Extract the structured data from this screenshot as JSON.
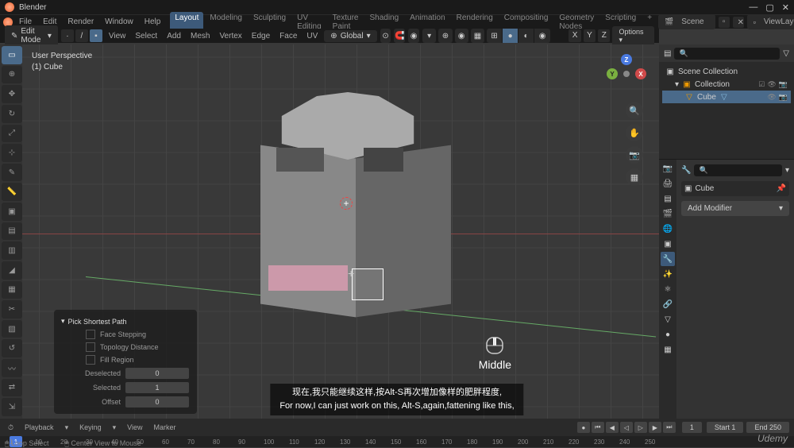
{
  "titlebar": {
    "app": "Blender"
  },
  "menus": {
    "file": "File",
    "edit": "Edit",
    "render": "Render",
    "window": "Window",
    "help": "Help"
  },
  "workspaces": {
    "layout": "Layout",
    "modeling": "Modeling",
    "sculpting": "Sculpting",
    "uv": "UV Editing",
    "texpaint": "Texture Paint",
    "shading": "Shading",
    "animation": "Animation",
    "rendering": "Rendering",
    "compositing": "Compositing",
    "geonodes": "Geometry Nodes",
    "scripting": "Scripting",
    "plus": "+"
  },
  "scene": {
    "label": "Scene",
    "viewlayer": "ViewLayer"
  },
  "toolbar": {
    "mode": "Edit Mode",
    "view": "View",
    "select": "Select",
    "add": "Add",
    "mesh": "Mesh",
    "vertex": "Vertex",
    "edge": "Edge",
    "face": "Face",
    "uv": "UV",
    "global": "Global",
    "options": "Options"
  },
  "viewport": {
    "info1": "User Perspective",
    "info2": "(1) Cube"
  },
  "gizmo": {
    "x": "X",
    "y": "Y",
    "z": "Z"
  },
  "xyz": {
    "x": "X",
    "y": "Y",
    "z": "Z"
  },
  "op_panel": {
    "title": "Pick Shortest Path",
    "face_stepping": "Face Stepping",
    "topo_dist": "Topology Distance",
    "fill_region": "Fill Region",
    "deselected": "Deselected",
    "deselected_v": "0",
    "selected": "Selected",
    "selected_v": "1",
    "offset": "Offset",
    "offset_v": "0"
  },
  "mouse": {
    "label": "Middle"
  },
  "subtitle": {
    "cn": "现在,我只能继续这样,按Alt-S再次增加像样的肥胖程度,",
    "en": "For now,I can just work on this, Alt-S,again,fattening like this,"
  },
  "outliner": {
    "scene_coll": "Scene Collection",
    "collection": "Collection",
    "cube": "Cube"
  },
  "props": {
    "cube": "Cube",
    "add_mod": "Add Modifier"
  },
  "timeline": {
    "playback": "Playback",
    "keying": "Keying",
    "view": "View",
    "marker": "Marker",
    "start": "Start",
    "start_v": "1",
    "end": "End",
    "end_v": "250",
    "current": "1"
  },
  "ruler": {
    "ticks": [
      "1",
      "10",
      "20",
      "30",
      "40",
      "50",
      "60",
      "70",
      "80",
      "90",
      "100",
      "110",
      "120",
      "130",
      "140",
      "150",
      "160",
      "170",
      "180",
      "190",
      "200",
      "210",
      "220",
      "230",
      "240",
      "250"
    ]
  },
  "status": {
    "loop": "Loop Select",
    "center": "Center View to Mouse"
  },
  "brand": "Udemy"
}
